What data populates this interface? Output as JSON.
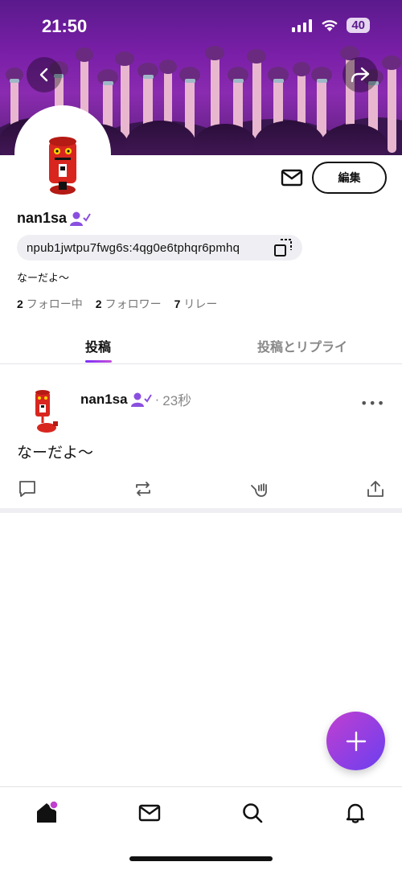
{
  "status": {
    "time": "21:50",
    "battery": "40"
  },
  "profile": {
    "username": "nan1sa",
    "npub": "npub1jwtpu7fwg6s:4qg0e6tphqr6pmhq",
    "bio": "なーだよ〜",
    "edit_label": "編集",
    "stats": [
      {
        "count": "2",
        "label": "フォロー中"
      },
      {
        "count": "2",
        "label": "フォロワー"
      },
      {
        "count": "7",
        "label": "リレー"
      }
    ]
  },
  "tabs": [
    {
      "label": "投稿"
    },
    {
      "label": "投稿とリプライ"
    }
  ],
  "post": {
    "author": "nan1sa",
    "separator": "·",
    "time": "23秒",
    "more": "•••",
    "content": "なーだよ〜"
  },
  "colors": {
    "accent_start": "#7b2ff7",
    "accent_end": "#c34fd8",
    "verified": "#8a4fe0",
    "notif_dot": "#c13fd0"
  },
  "icons": {
    "back": "chevron-left-icon",
    "share": "share-icon",
    "mail": "mail-icon",
    "verified": "verified-user-icon",
    "copy": "copy-icon",
    "reply": "comment-icon",
    "repost": "repost-icon",
    "reaction": "shaka-icon",
    "export": "upload-icon",
    "compose": "plus-icon",
    "home": "home-icon",
    "dm": "mail-icon",
    "search": "search-icon",
    "notifications": "bell-icon"
  }
}
